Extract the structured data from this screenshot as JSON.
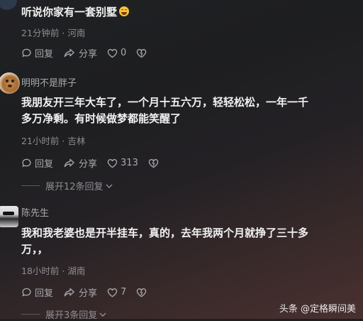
{
  "comments": [
    {
      "text": "听说你家有一套别墅",
      "meta": "21分钟前 · 河南",
      "reply": "回复",
      "share": "分享",
      "likes": "0"
    },
    {
      "author": "明明不是胖子",
      "text_line1": "我朋友开三年大车了，一个月十五六万，轻轻松松，一年一千",
      "text_line2": "多万净剩。有时候做梦都能笑醒了",
      "meta": "21小时前 · 吉林",
      "reply": "回复",
      "share": "分享",
      "likes": "313",
      "expand": "展开12条回复"
    },
    {
      "author": "陈先生",
      "text_line1": "我和我老婆也是开半挂车，真的，去年我两个月就挣了三十多",
      "text_line2": "万，，",
      "meta": "18小时前 · 湖南",
      "reply": "回复",
      "share": "分享",
      "likes": "7",
      "expand": "展开3条回复"
    }
  ],
  "watermark": "头条 @定格瞬间美",
  "icons": [
    "reply-icon",
    "share-icon",
    "heart-icon",
    "dislike-icon",
    "chevron-down-icon",
    "laugh-emoji"
  ]
}
